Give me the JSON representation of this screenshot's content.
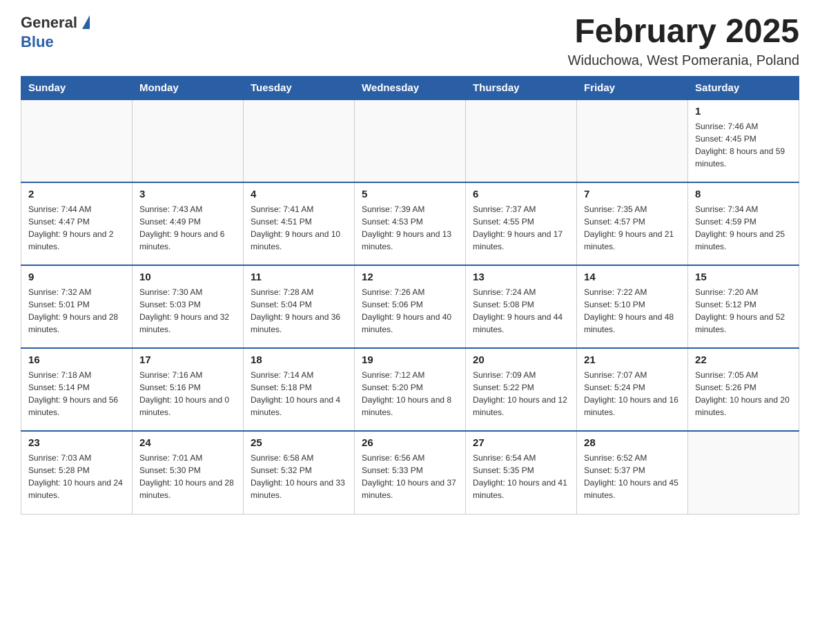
{
  "header": {
    "logo_general": "General",
    "logo_blue": "Blue",
    "title": "February 2025",
    "subtitle": "Widuchowa, West Pomerania, Poland"
  },
  "days_of_week": [
    "Sunday",
    "Monday",
    "Tuesday",
    "Wednesday",
    "Thursday",
    "Friday",
    "Saturday"
  ],
  "weeks": [
    [
      {
        "day": "",
        "info": ""
      },
      {
        "day": "",
        "info": ""
      },
      {
        "day": "",
        "info": ""
      },
      {
        "day": "",
        "info": ""
      },
      {
        "day": "",
        "info": ""
      },
      {
        "day": "",
        "info": ""
      },
      {
        "day": "1",
        "info": "Sunrise: 7:46 AM\nSunset: 4:45 PM\nDaylight: 8 hours and 59 minutes."
      }
    ],
    [
      {
        "day": "2",
        "info": "Sunrise: 7:44 AM\nSunset: 4:47 PM\nDaylight: 9 hours and 2 minutes."
      },
      {
        "day": "3",
        "info": "Sunrise: 7:43 AM\nSunset: 4:49 PM\nDaylight: 9 hours and 6 minutes."
      },
      {
        "day": "4",
        "info": "Sunrise: 7:41 AM\nSunset: 4:51 PM\nDaylight: 9 hours and 10 minutes."
      },
      {
        "day": "5",
        "info": "Sunrise: 7:39 AM\nSunset: 4:53 PM\nDaylight: 9 hours and 13 minutes."
      },
      {
        "day": "6",
        "info": "Sunrise: 7:37 AM\nSunset: 4:55 PM\nDaylight: 9 hours and 17 minutes."
      },
      {
        "day": "7",
        "info": "Sunrise: 7:35 AM\nSunset: 4:57 PM\nDaylight: 9 hours and 21 minutes."
      },
      {
        "day": "8",
        "info": "Sunrise: 7:34 AM\nSunset: 4:59 PM\nDaylight: 9 hours and 25 minutes."
      }
    ],
    [
      {
        "day": "9",
        "info": "Sunrise: 7:32 AM\nSunset: 5:01 PM\nDaylight: 9 hours and 28 minutes."
      },
      {
        "day": "10",
        "info": "Sunrise: 7:30 AM\nSunset: 5:03 PM\nDaylight: 9 hours and 32 minutes."
      },
      {
        "day": "11",
        "info": "Sunrise: 7:28 AM\nSunset: 5:04 PM\nDaylight: 9 hours and 36 minutes."
      },
      {
        "day": "12",
        "info": "Sunrise: 7:26 AM\nSunset: 5:06 PM\nDaylight: 9 hours and 40 minutes."
      },
      {
        "day": "13",
        "info": "Sunrise: 7:24 AM\nSunset: 5:08 PM\nDaylight: 9 hours and 44 minutes."
      },
      {
        "day": "14",
        "info": "Sunrise: 7:22 AM\nSunset: 5:10 PM\nDaylight: 9 hours and 48 minutes."
      },
      {
        "day": "15",
        "info": "Sunrise: 7:20 AM\nSunset: 5:12 PM\nDaylight: 9 hours and 52 minutes."
      }
    ],
    [
      {
        "day": "16",
        "info": "Sunrise: 7:18 AM\nSunset: 5:14 PM\nDaylight: 9 hours and 56 minutes."
      },
      {
        "day": "17",
        "info": "Sunrise: 7:16 AM\nSunset: 5:16 PM\nDaylight: 10 hours and 0 minutes."
      },
      {
        "day": "18",
        "info": "Sunrise: 7:14 AM\nSunset: 5:18 PM\nDaylight: 10 hours and 4 minutes."
      },
      {
        "day": "19",
        "info": "Sunrise: 7:12 AM\nSunset: 5:20 PM\nDaylight: 10 hours and 8 minutes."
      },
      {
        "day": "20",
        "info": "Sunrise: 7:09 AM\nSunset: 5:22 PM\nDaylight: 10 hours and 12 minutes."
      },
      {
        "day": "21",
        "info": "Sunrise: 7:07 AM\nSunset: 5:24 PM\nDaylight: 10 hours and 16 minutes."
      },
      {
        "day": "22",
        "info": "Sunrise: 7:05 AM\nSunset: 5:26 PM\nDaylight: 10 hours and 20 minutes."
      }
    ],
    [
      {
        "day": "23",
        "info": "Sunrise: 7:03 AM\nSunset: 5:28 PM\nDaylight: 10 hours and 24 minutes."
      },
      {
        "day": "24",
        "info": "Sunrise: 7:01 AM\nSunset: 5:30 PM\nDaylight: 10 hours and 28 minutes."
      },
      {
        "day": "25",
        "info": "Sunrise: 6:58 AM\nSunset: 5:32 PM\nDaylight: 10 hours and 33 minutes."
      },
      {
        "day": "26",
        "info": "Sunrise: 6:56 AM\nSunset: 5:33 PM\nDaylight: 10 hours and 37 minutes."
      },
      {
        "day": "27",
        "info": "Sunrise: 6:54 AM\nSunset: 5:35 PM\nDaylight: 10 hours and 41 minutes."
      },
      {
        "day": "28",
        "info": "Sunrise: 6:52 AM\nSunset: 5:37 PM\nDaylight: 10 hours and 45 minutes."
      },
      {
        "day": "",
        "info": ""
      }
    ]
  ]
}
